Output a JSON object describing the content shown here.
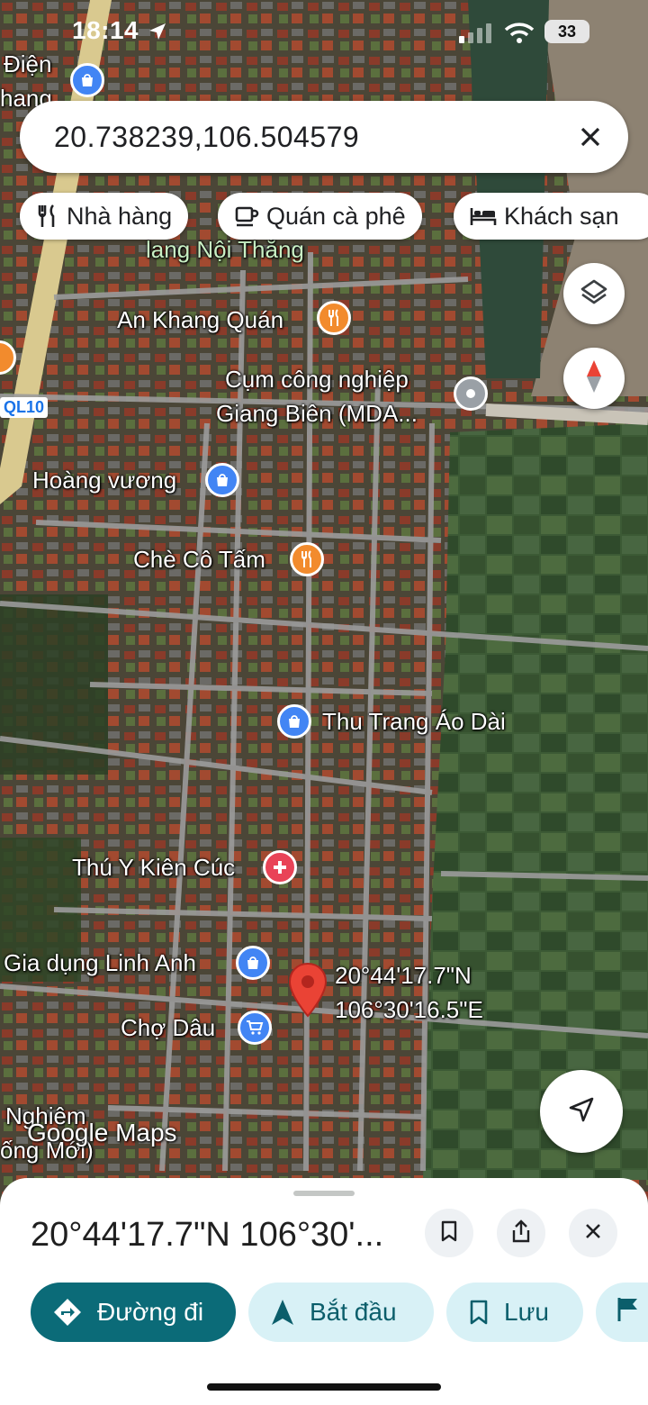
{
  "status_bar": {
    "time": "18:14",
    "battery": "33"
  },
  "search": {
    "query": "20.738239,106.504579"
  },
  "chips": [
    {
      "label": "Nhà hàng",
      "icon": "fork-knife-icon"
    },
    {
      "label": "Quán cà phê",
      "icon": "coffee-cup-icon"
    },
    {
      "label": "Khách sạn",
      "icon": "bed-icon"
    }
  ],
  "map": {
    "road_shield": "QL10",
    "attribution": "Google Maps",
    "places": {
      "edge_top_1": "Điện",
      "edge_top_2": "hang",
      "lang": "lang Nội Thắng",
      "an_khang": "An Khang Quán",
      "cum_cn_1": "Cụm công nghiệp",
      "cum_cn_2": "Giang Biên (MDA...",
      "hoang_vuong": "Hoàng vương",
      "che_co_tam": "Chè Cô Tấm",
      "thu_trang": "Thu Trang Áo Dài",
      "thu_y": "Thú Y Kiên Cúc",
      "gia_dung": "Gia dụng Linh Anh",
      "cho_dau": "Chợ Dâu",
      "nghiem_1": "Nghiêm",
      "nghiem_2": "ống Mới)"
    },
    "pin": {
      "lat_dms": "20°44'17.7\"N",
      "lng_dms": "106°30'16.5\"E",
      "color": "#ea4335"
    }
  },
  "sheet": {
    "title": "20°44'17.7\"N 106°30'...",
    "actions": [
      {
        "label": "Đường đi",
        "icon": "directions-icon"
      },
      {
        "label": "Bắt đầu",
        "icon": "navigation-arrow-icon"
      },
      {
        "label": "Lưu",
        "icon": "bookmark-icon"
      }
    ]
  },
  "colors": {
    "accent": "#0b6b78",
    "accent_light": "#d8f1f6",
    "poi_blue": "#4285f4",
    "poi_orange": "#f28b2d"
  }
}
